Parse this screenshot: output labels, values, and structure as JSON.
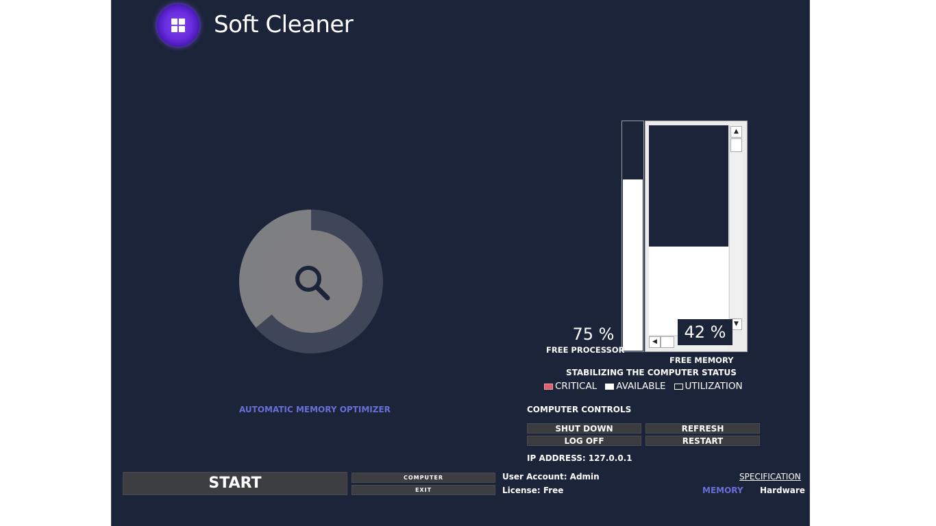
{
  "app": {
    "title": "Soft Cleaner"
  },
  "optimizer": {
    "label": "AUTOMATIC MEMORY OPTIMIZER"
  },
  "processor": {
    "value_text": "75 %",
    "label": "FREE PROCESSOR",
    "level": 0.75
  },
  "memory": {
    "value_text": "42 %",
    "label": "FREE MEMORY",
    "level": 0.42
  },
  "status": {
    "title": "STABILIZING THE COMPUTER STATUS",
    "legend": [
      {
        "label": "CRITICAL",
        "color": "#e06070"
      },
      {
        "label": "AVAILABLE",
        "color": "#ffffff"
      },
      {
        "label": "UTILIZATION",
        "color": "transparent"
      }
    ]
  },
  "controls": {
    "title": "COMPUTER CONTROLS",
    "shutdown": "SHUT DOWN",
    "refresh": "REFRESH",
    "logoff": "LOG OFF",
    "restart": "RESTART"
  },
  "ip": {
    "text": "IP ADDRESS: 127.0.0.1"
  },
  "footer": {
    "start": "START",
    "computer": "COMPUTER",
    "exit": "EXIT",
    "user_account": "User Account: Admin",
    "license": "License: Free",
    "specification": "SPECIFICATION",
    "memory": "MEMORY",
    "hardware": "Hardware"
  },
  "icons": {
    "logo": "four-squares-icon",
    "search": "search-icon",
    "scroll_up": "arrow-up-icon",
    "scroll_down": "arrow-down-icon",
    "scroll_left": "arrow-left-icon"
  }
}
